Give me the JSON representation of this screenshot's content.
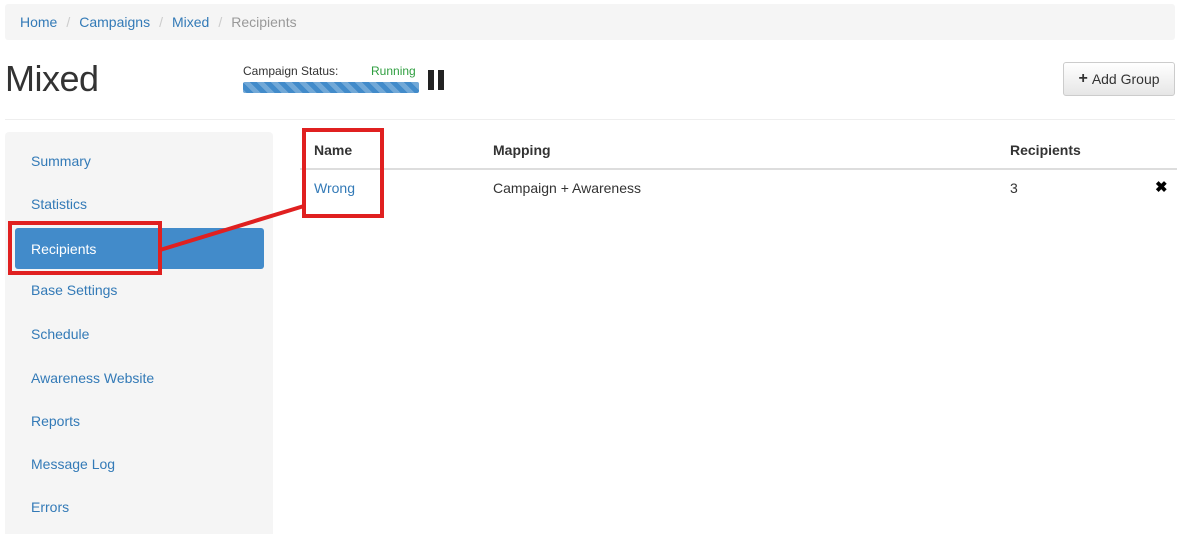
{
  "breadcrumb": {
    "items": [
      {
        "label": "Home",
        "active": false
      },
      {
        "label": "Campaigns",
        "active": false
      },
      {
        "label": "Mixed",
        "active": false
      },
      {
        "label": "Recipients",
        "active": true
      }
    ],
    "separator": "/"
  },
  "page": {
    "title": "Mixed"
  },
  "campaign_status": {
    "label": "Campaign Status:",
    "value": "Running",
    "value_color": "#2e9e3f",
    "progress_fraction": 1.0,
    "progress_color": "#428bca",
    "control_icon": "pause-icon"
  },
  "toolbar": {
    "add_group_label": "Add Group",
    "add_group_icon": "plus-icon"
  },
  "sidebar": {
    "active_color": "#428bca",
    "items": [
      {
        "label": "Summary",
        "active": false
      },
      {
        "label": "Statistics",
        "active": false
      },
      {
        "label": "Recipients",
        "active": true
      },
      {
        "label": "Base Settings",
        "active": false
      },
      {
        "label": "Schedule",
        "active": false
      },
      {
        "label": "Awareness Website",
        "active": false
      },
      {
        "label": "Reports",
        "active": false
      },
      {
        "label": "Message Log",
        "active": false
      },
      {
        "label": "Errors",
        "active": false
      }
    ]
  },
  "table": {
    "columns": [
      "Name",
      "Mapping",
      "Recipients"
    ],
    "rows": [
      {
        "name": "Wrong",
        "mapping": "Campaign + Awareness",
        "recipients": "3",
        "delete_icon": "close-icon"
      }
    ]
  },
  "annotation": {
    "color": "#e02020"
  }
}
